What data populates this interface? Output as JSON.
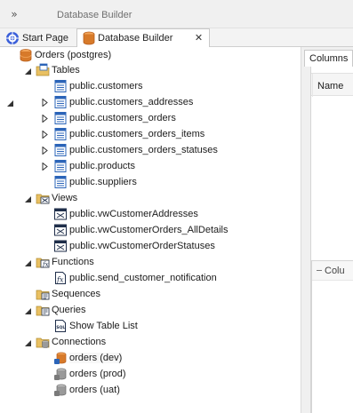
{
  "titlebar": {
    "title": "Database Builder",
    "expand_icon": "double-chevron-right-icon"
  },
  "tabs": [
    {
      "label": "Start Page",
      "icon": "start-page-icon",
      "active": false
    },
    {
      "label": "Database Builder",
      "icon": "database-icon",
      "active": true,
      "close": "✕"
    }
  ],
  "tree": {
    "root": {
      "label": "Orders (postgres)",
      "icon": "database-icon",
      "expanded": true
    },
    "tables": {
      "label": "Tables",
      "expanded": true,
      "items": [
        {
          "label": "public.customers",
          "expandable": false
        },
        {
          "label": "public.customers_addresses",
          "expandable": true
        },
        {
          "label": "public.customers_orders",
          "expandable": true
        },
        {
          "label": "public.customers_orders_items",
          "expandable": true
        },
        {
          "label": "public.customers_orders_statuses",
          "expandable": true
        },
        {
          "label": "public.products",
          "expandable": true
        },
        {
          "label": "public.suppliers",
          "expandable": false
        }
      ]
    },
    "views": {
      "label": "Views",
      "expanded": true,
      "items": [
        {
          "label": "public.vwCustomerAddresses"
        },
        {
          "label": "public.vwCustomerOrders_AllDetails"
        },
        {
          "label": "public.vwCustomerOrderStatuses"
        }
      ]
    },
    "functions": {
      "label": "Functions",
      "expanded": true,
      "items": [
        {
          "label": "public.send_customer_notification"
        }
      ]
    },
    "sequences": {
      "label": "Sequences"
    },
    "queries": {
      "label": "Queries",
      "expanded": true,
      "items": [
        {
          "label": "Show Table List"
        }
      ]
    },
    "connections": {
      "label": "Connections",
      "expanded": true,
      "items": [
        {
          "label": "orders (dev)",
          "active": true
        },
        {
          "label": "orders (prod)",
          "active": false
        },
        {
          "label": "orders (uat)",
          "active": false
        }
      ]
    }
  },
  "right_panel": {
    "tab_label": "Columns",
    "column_header": "Name",
    "lower_header": "Colu"
  },
  "colors": {
    "table_icon_blue": "#2b64b8",
    "folder_yellow": "#e9c062",
    "db_orange": "#d77a2a",
    "panel_bg": "#f0f0f0"
  }
}
